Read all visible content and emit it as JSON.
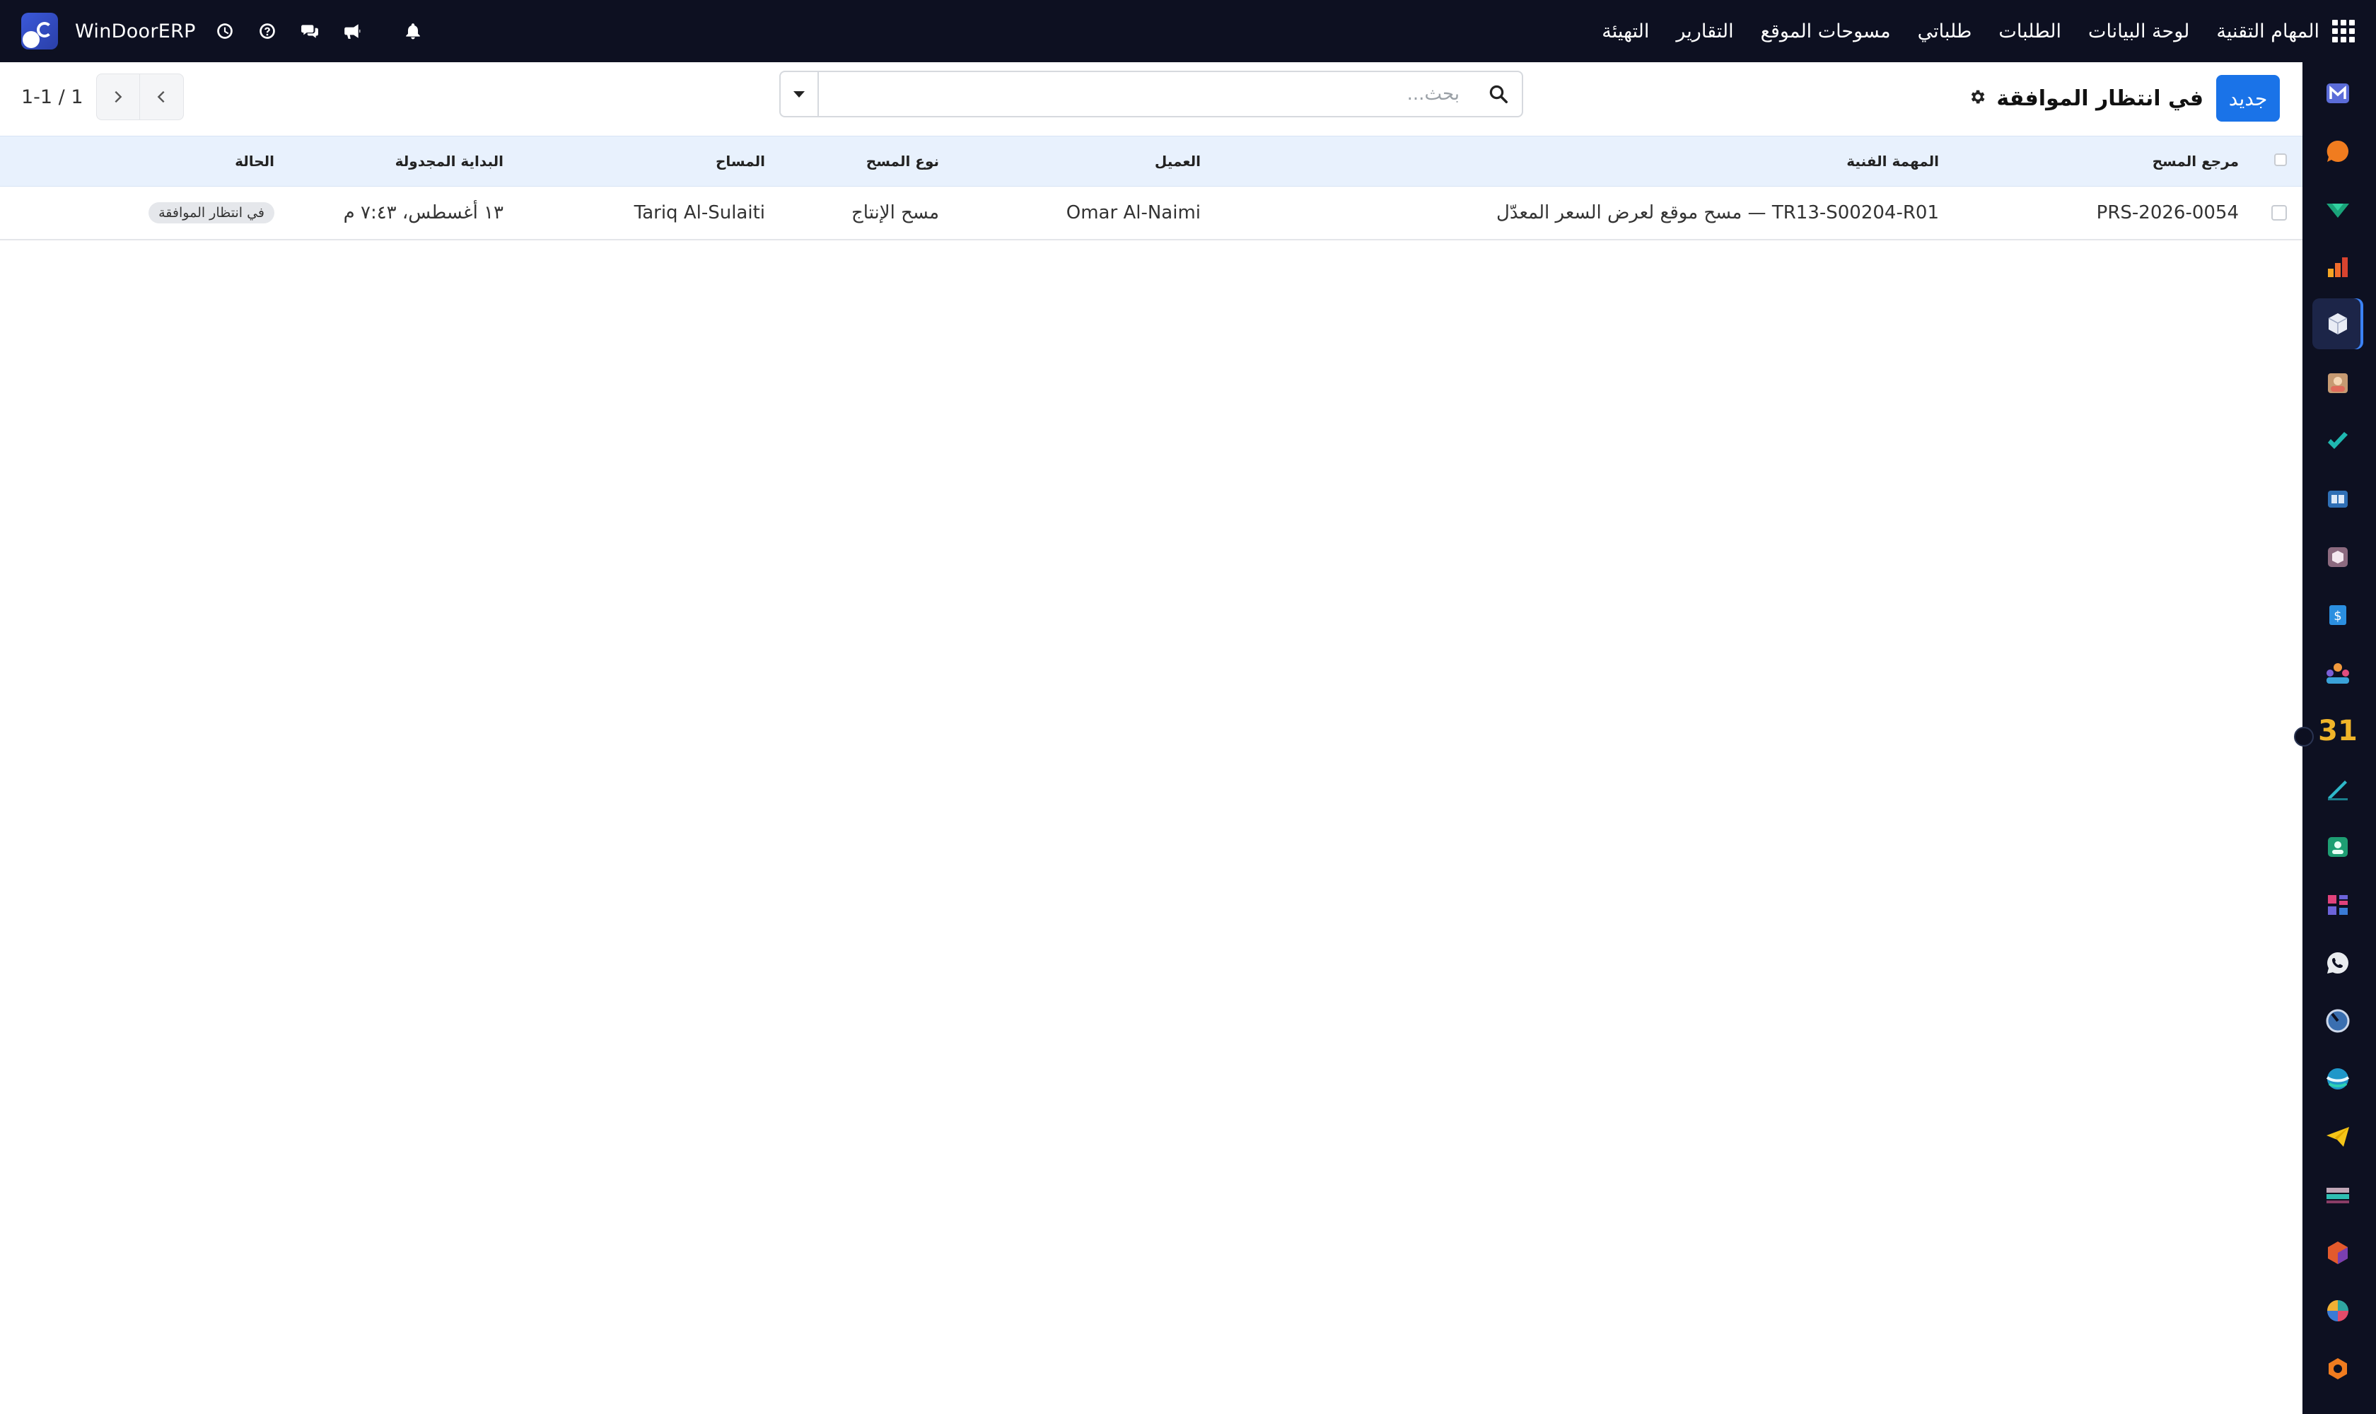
{
  "navbar": {
    "brand": "WinDoorERP",
    "menu": [
      "المهام التقنية",
      "لوحة البيانات",
      "الطلبات",
      "طلباتي",
      "مسوحات الموقع",
      "التقارير",
      "التهيئة"
    ],
    "icons": [
      "apps-icon",
      "clock-icon",
      "help-icon",
      "chat-icon",
      "megaphone-icon",
      "bell-icon"
    ]
  },
  "control": {
    "new_label": "جديد",
    "view_title": "في انتظار الموافقة",
    "search_placeholder": "بحث...",
    "pager_value": "1-1 / 1"
  },
  "table": {
    "columns": [
      "مرجع المسح",
      "المهمة الفنية",
      "العميل",
      "نوع المسح",
      "المساح",
      "البداية المجدولة",
      "الحالة"
    ],
    "rows": [
      {
        "reference": "PRS-2026-0054",
        "task": "TR13-S00204-R01 — مسح موقع لعرض السعر المعدّل",
        "customer": "Omar Al-Naimi",
        "survey_type": "مسح الإنتاج",
        "surveyor": "Tariq Al-Sulaiti",
        "scheduled_start": "١٣ أغسطس، ٧:٤٣ م",
        "status": "في انتظار الموافقة"
      }
    ]
  },
  "appbar": {
    "apps": [
      "mail-app",
      "discuss-app",
      "project-app",
      "dashboard-app",
      "inventory-app",
      "contacts-app",
      "todo-app",
      "knowledge-app",
      "product-app",
      "invoicing-app",
      "employees-app",
      "calendar-app",
      "sign-app",
      "hr-app",
      "documents-app",
      "whatsapp-app",
      "timesheet-app",
      "website-app",
      "email-marketing-app",
      "accounting-app",
      "manufacturing-app",
      "pos-app",
      "settings-app"
    ],
    "active_app": "inventory-app"
  }
}
